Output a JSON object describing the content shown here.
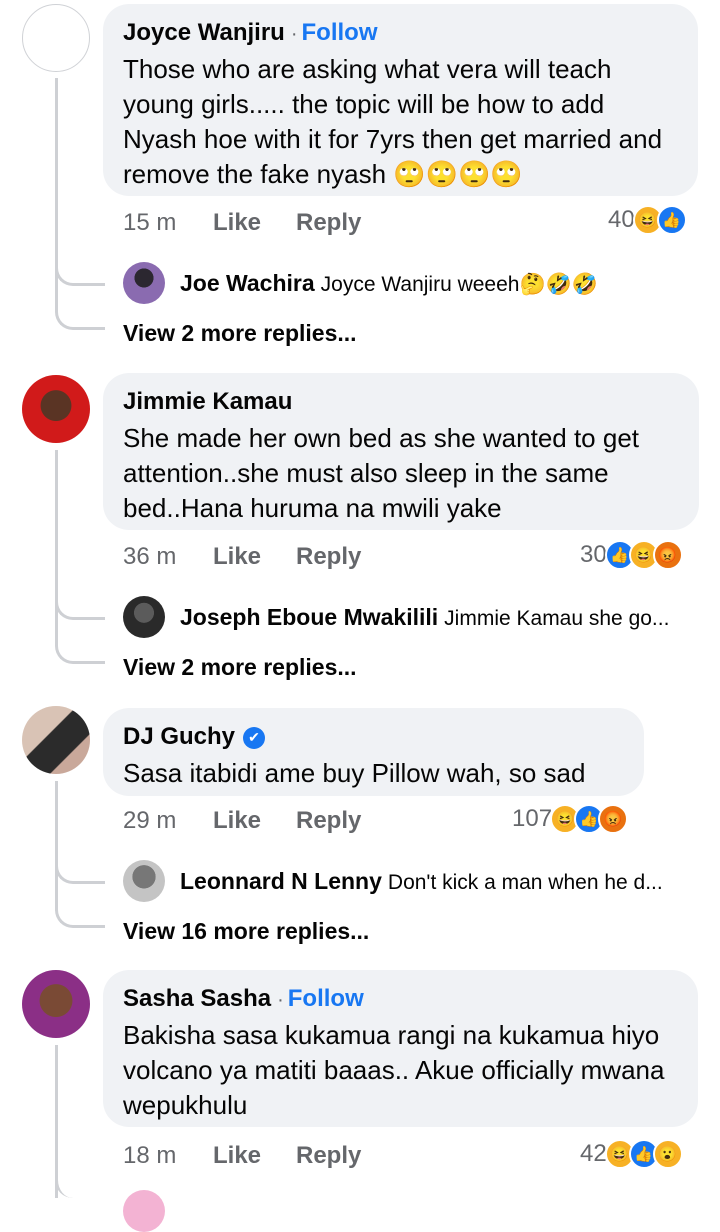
{
  "comments": [
    {
      "author": "Joyce Wanjiru",
      "follow": "Follow",
      "text": "Those who are asking what vera will teach young girls..... the topic will be how to add Nyash hoe with it for 7yrs then get married and remove the fake nyash 🙄🙄🙄🙄",
      "time": "15 m",
      "like": "Like",
      "reply": "Reply",
      "reaction_count": "40",
      "reactions": [
        "haha",
        "like"
      ],
      "reply_preview": {
        "author": "Joe Wachira",
        "text": "Joyce Wanjiru weeeh🤔🤣🤣"
      },
      "view_more": "View 2 more replies..."
    },
    {
      "author": "Jimmie Kamau",
      "text": "She made her own bed as she wanted to get attention..she must also sleep in the same bed..Hana huruma na mwili yake",
      "time": "36 m",
      "like": "Like",
      "reply": "Reply",
      "reaction_count": "30",
      "reactions": [
        "like",
        "haha",
        "angry"
      ],
      "reply_preview": {
        "author": "Joseph Eboue Mwakilili",
        "text": "Jimmie Kamau she go..."
      },
      "view_more": "View 2 more replies..."
    },
    {
      "author": "DJ Guchy",
      "verified": true,
      "text": "Sasa itabidi ame buy Pillow wah, so sad",
      "time": "29 m",
      "like": "Like",
      "reply": "Reply",
      "reaction_count": "107",
      "reactions": [
        "haha",
        "like",
        "angry"
      ],
      "reply_preview": {
        "author": "Leonnard N Lenny",
        "text": "Don't kick a man when he d..."
      },
      "view_more": "View 16 more replies..."
    },
    {
      "author": "Sasha Sasha",
      "follow": "Follow",
      "text": "Bakisha sasa kukamua rangi na kukamua hiyo volcano ya matiti baaas.. Akue officially mwana wepukhulu",
      "time": "18 m",
      "like": "Like",
      "reply": "Reply",
      "reaction_count": "42",
      "reactions": [
        "haha",
        "like",
        "wow"
      ]
    }
  ],
  "icons": {
    "haha": "😆",
    "like": "👍",
    "angry": "😡",
    "wow": "😮",
    "verified": "✔"
  },
  "colors": {
    "link_blue": "#1877f2",
    "bubble": "#f0f2f5",
    "muted": "#65676b"
  }
}
